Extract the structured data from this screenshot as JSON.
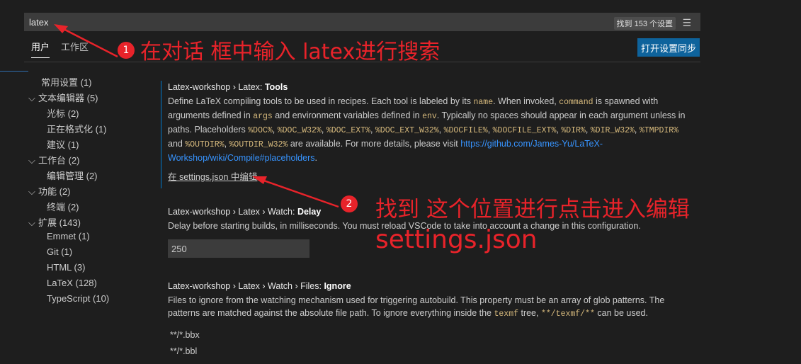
{
  "search": {
    "query": "latex",
    "count": "找到 153 个设置",
    "filter_icon": "filter-icon"
  },
  "tabs": {
    "user": "用户",
    "workspace": "工作区"
  },
  "sync_button": "打开设置同步",
  "toc": [
    {
      "label": "常用设置 (1)",
      "chevron": ""
    },
    {
      "label": "文本编辑器 (5)",
      "chevron": "v"
    },
    {
      "label": "光标 (2)",
      "chevron": ""
    },
    {
      "label": "正在格式化 (1)",
      "chevron": ""
    },
    {
      "label": "建议 (1)",
      "chevron": ""
    },
    {
      "label": "工作台 (2)",
      "chevron": "v"
    },
    {
      "label": "编辑管理 (2)",
      "chevron": ""
    },
    {
      "label": "功能 (2)",
      "chevron": "v"
    },
    {
      "label": "终端 (2)",
      "chevron": ""
    },
    {
      "label": "扩展 (143)",
      "chevron": "v"
    },
    {
      "label": "Emmet (1)",
      "chevron": ""
    },
    {
      "label": "Git (1)",
      "chevron": ""
    },
    {
      "label": "HTML (3)",
      "chevron": ""
    },
    {
      "label": "LaTeX (128)",
      "chevron": ""
    },
    {
      "label": "TypeScript (10)",
      "chevron": ""
    }
  ],
  "setting1": {
    "prefix": "Latex-workshop › Latex: ",
    "name": "Tools",
    "d1": "Define LaTeX compiling tools to be used in recipes. Each tool is labeled by its ",
    "c1": "name",
    "d2": ". When invoked, ",
    "c2": "command",
    "d3": " is spawned with arguments defined in ",
    "c3": "args",
    "d4": " and environment variables defined in ",
    "c4": "env",
    "d5": ". Typically no spaces should appear in each argument unless in paths. Placeholders ",
    "c5": "%DOC%",
    "c6": "%DOC_W32%",
    "c7": "%DOC_EXT%",
    "c8": "%DOC_EXT_W32%",
    "c9": "%DOCFILE%",
    "c10": "%DOCFILE_EXT%",
    "c11": "%DIR%",
    "c12": "%DIR_W32%",
    "c13": "%TMPDIR%",
    "d6": " and ",
    "c14": "%OUTDIR%",
    "c15": "%OUTDIR_W32%",
    "d7": " are available. For more details, please visit ",
    "link": "https://github.com/James-Yu/LaTeX-Workshop/wiki/Compile#placeholders",
    "d8": ".",
    "edit_link": "在 settings.json 中编辑"
  },
  "setting2": {
    "prefix": "Latex-workshop › Latex › Watch: ",
    "name": "Delay",
    "desc": "Delay before starting builds, in milliseconds. You must reload VSCode to take into account a change in this configuration.",
    "value": "250"
  },
  "setting3": {
    "prefix": "Latex-workshop › Latex › Watch › Files: ",
    "name": "Ignore",
    "d1": "Files to ignore from the watching mechanism used for triggering autobuild. This property must be an array of glob patterns. The patterns are matched against the absolute file path. To ignore everything inside the ",
    "c1": "texmf",
    "d2": " tree, ",
    "c2": "**/texmf/**",
    "d3": " can be used.",
    "items": [
      "**/*.bbx",
      "**/*.bbl"
    ]
  },
  "annotations": {
    "badge1": "1",
    "text1": "在对话 框中输入 latex进行搜索",
    "badge2": "2",
    "text2": "找到 这个位置进行点击进入编辑",
    "text3": "settings.json",
    "color": "#e8232a"
  }
}
